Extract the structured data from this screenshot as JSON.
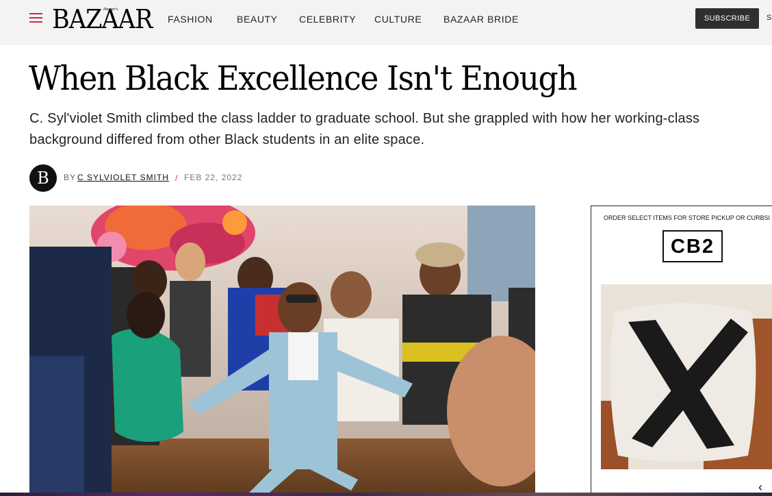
{
  "header": {
    "logo": "BAZAAR",
    "logo_sub": "Harper's",
    "nav": [
      "FASHION",
      "BEAUTY",
      "CELEBRITY",
      "CULTURE",
      "BAZAAR BRIDE"
    ],
    "subscribe_label": "SUBSCRIBE",
    "signin_label": "S"
  },
  "article": {
    "title": "When Black Excellence Isn't Enough",
    "dek": "C. Syl'violet Smith climbed the class ladder to graduate school. But she grappled with how her working-class background differed from other Black students in an elite space.",
    "byline": {
      "avatar_letter": "B",
      "by": "BY",
      "author": "C SYLVIOLET SMITH",
      "separator": "/",
      "date": "FEB 22, 2022"
    }
  },
  "ad": {
    "tagline": "ORDER SELECT ITEMS FOR STORE PICKUP OR CURBSI",
    "brand": "CB2",
    "arrow": "‹"
  },
  "colors": {
    "accent": "#d8243b",
    "topbar": "#f3f3f3",
    "button": "#2f2f2f"
  }
}
